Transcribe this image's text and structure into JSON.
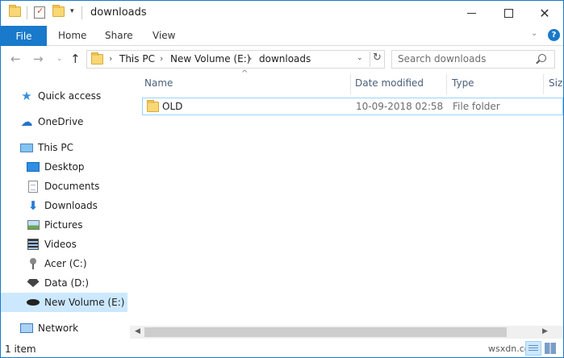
{
  "window": {
    "title": "downloads",
    "controls": {
      "minimize": "—",
      "maximize": "☐",
      "close": "✕"
    }
  },
  "qat": {
    "dropdown": "▾"
  },
  "ribbon": {
    "tabs": [
      "File",
      "Home",
      "Share",
      "View"
    ],
    "collapse": "⌄",
    "help": "?"
  },
  "address": {
    "back": "←",
    "forward": "→",
    "recent": "⌄",
    "up": "↑",
    "crumbs": [
      "This PC",
      "New Volume (E:)",
      "downloads"
    ],
    "crumb_sep": "›",
    "dropdown": "⌄",
    "refresh": "↻"
  },
  "search": {
    "placeholder": "Search downloads"
  },
  "sidebar": {
    "items": [
      {
        "label": "Quick access",
        "icon": "star-icon"
      },
      {
        "label": "OneDrive",
        "icon": "cloud-icon"
      },
      {
        "label": "This PC",
        "icon": "computer-icon"
      },
      {
        "label": "Desktop",
        "icon": "desktop-icon"
      },
      {
        "label": "Documents",
        "icon": "documents-icon"
      },
      {
        "label": "Downloads",
        "icon": "download-arrow-icon"
      },
      {
        "label": "Pictures",
        "icon": "pictures-icon"
      },
      {
        "label": "Videos",
        "icon": "videos-icon"
      },
      {
        "label": "Acer (C:)",
        "icon": "drive-icon"
      },
      {
        "label": "Data (D:)",
        "icon": "superman-drive-icon"
      },
      {
        "label": "New Volume (E:)",
        "icon": "batman-drive-icon",
        "selected": true
      },
      {
        "label": "Network",
        "icon": "network-icon"
      }
    ]
  },
  "columns": {
    "sort_indicator": "^",
    "headers": [
      "Name",
      "Date modified",
      "Type",
      "Size"
    ]
  },
  "files": [
    {
      "name": "OLD",
      "date": "10-09-2018 02:58",
      "type": "File folder",
      "icon": "folder-icon"
    }
  ],
  "scrollbar": {
    "left": "◀",
    "right": "▶"
  },
  "status": {
    "count": "1 item"
  },
  "watermark": "wsxdn.com",
  "colors": {
    "accent": "#1979ca",
    "selection": "#cce8ff",
    "selection_border": "#99d1ff",
    "header_text": "#4c607a"
  }
}
